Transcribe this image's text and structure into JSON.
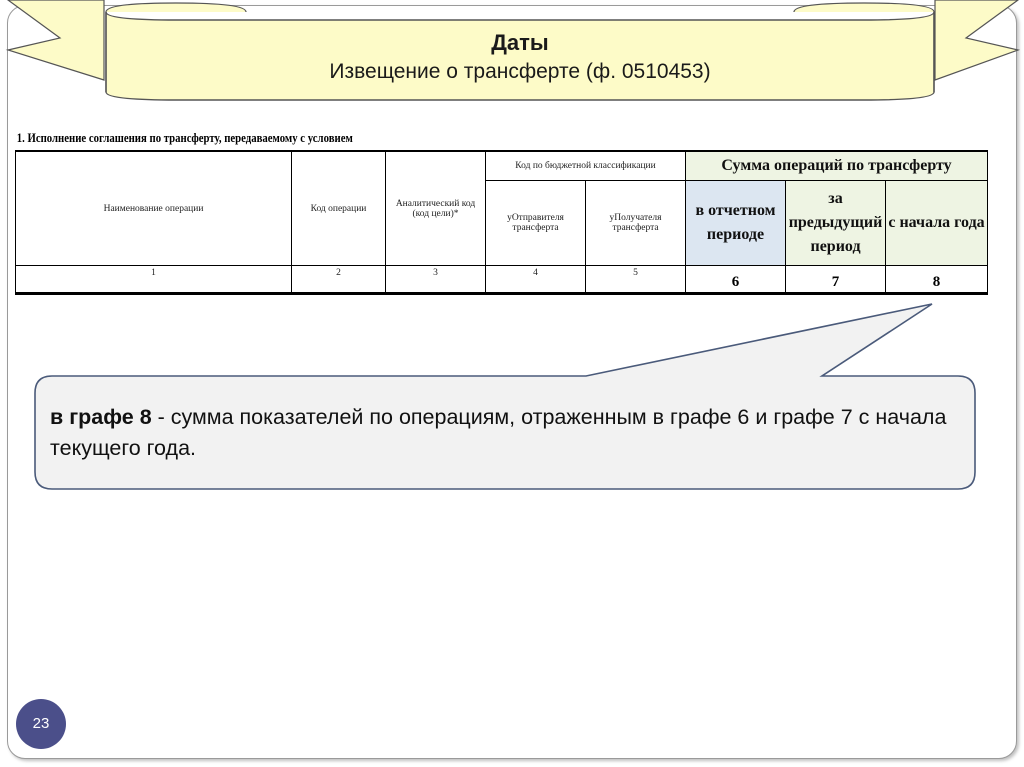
{
  "banner": {
    "title": "Даты",
    "subtitle": "Извещение о трансферте (ф. 0510453)"
  },
  "table": {
    "caption": "1. Исполнение соглашения по трансферту, передаваемому с условием",
    "headers": {
      "operation_name": "Наименование операции",
      "operation_code": "Код операции",
      "analytic_code": "Аналитический код (код цели)*",
      "budget_code_group": "Код по бюджетной классификации",
      "sender": "уОтправителя трансферта",
      "receiver": "уПолучателя трансферта",
      "sum_group": "Сумма операций по трансферту",
      "current_period": "в отчетном периоде",
      "previous_period": "за предыдущий период",
      "year_start": "с начала года"
    },
    "column_numbers": [
      "1",
      "2",
      "3",
      "4",
      "5",
      "6",
      "7",
      "8"
    ]
  },
  "callout": {
    "bold_part": "в графе 8",
    "rest": " - сумма показателей по операциям, отраженным в графе 6 и графе 7 с начала текущего года."
  },
  "page_number": "23",
  "colors": {
    "banner_fill": "#fdfbc8",
    "banner_border": "#555555",
    "sum_fill": "#eef4e3",
    "current_fill": "#dce6f1",
    "callout_fill": "#f2f2f2",
    "badge_fill": "#4b4f8a"
  }
}
